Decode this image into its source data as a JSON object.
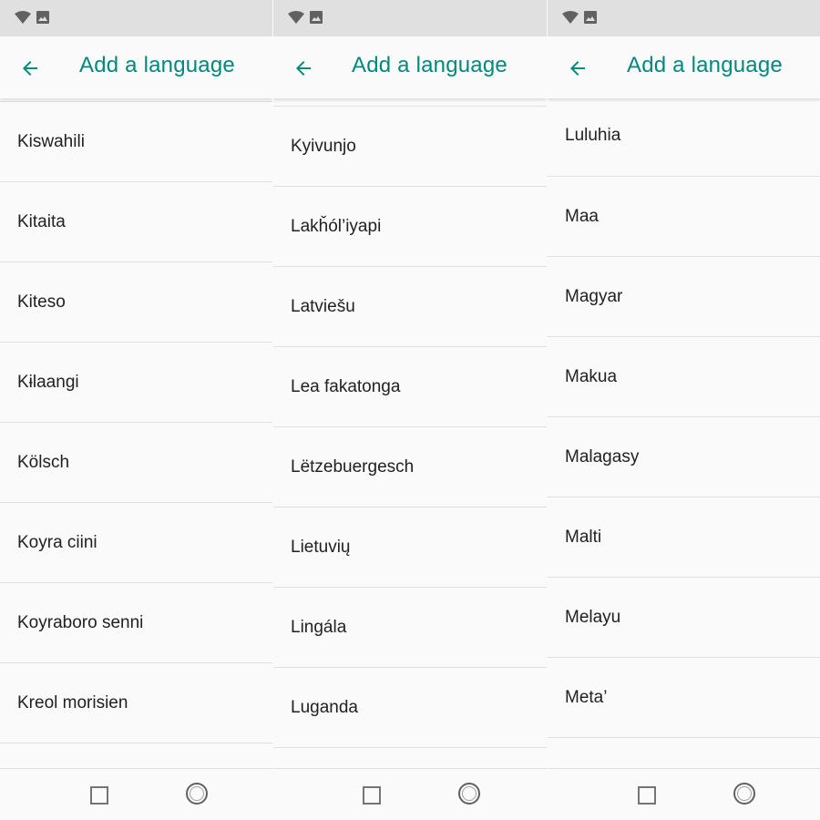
{
  "colors": {
    "accent": "#00897b",
    "status_bar": "#e0e0e0",
    "background": "#fafafa",
    "text": "#212121"
  },
  "status_icons": [
    "wifi-icon",
    "image-icon"
  ],
  "nav_icons": [
    "recent-apps-square-icon",
    "home-circle-icon"
  ],
  "screens": [
    {
      "title": "Add a language",
      "items": [
        "Kiswahili",
        "Kitaita",
        "Kiteso",
        "Kɨlaangi",
        "Kölsch",
        "Koyra ciini",
        "Koyraboro senni",
        "Kreol morisien"
      ]
    },
    {
      "title": "Add a language",
      "items": [
        "Kyivunjo",
        "Lakȟól’iyapi",
        "Latviešu",
        "Lea fakatonga",
        "Lëtzebuergesch",
        "Lietuvių",
        "Lingála",
        "Luganda"
      ]
    },
    {
      "title": "Add a language",
      "items": [
        "Luluhia",
        "Maa",
        "Magyar",
        "Makua",
        "Malagasy",
        "Malti",
        "Melayu",
        "Meta’"
      ]
    }
  ]
}
